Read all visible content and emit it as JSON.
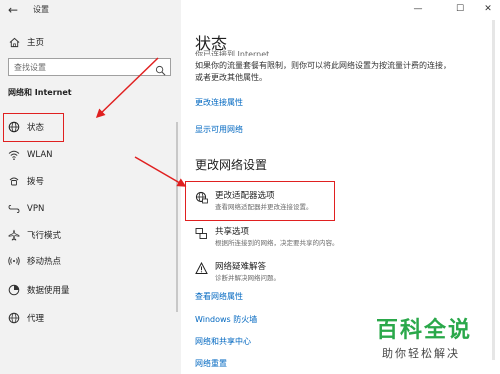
{
  "window": {
    "title": "设置",
    "back_icon": "←",
    "minimize_icon": "—",
    "maximize_icon": "☐",
    "close_icon": "✕"
  },
  "sidebar": {
    "home_label": "主页",
    "search_placeholder": "查找设置",
    "section_title": "网络和 Internet",
    "items": [
      {
        "label": "状态",
        "icon": "status-globe-icon"
      },
      {
        "label": "WLAN",
        "icon": "wifi-icon"
      },
      {
        "label": "拨号",
        "icon": "dialup-icon"
      },
      {
        "label": "VPN",
        "icon": "vpn-icon"
      },
      {
        "label": "飞行模式",
        "icon": "airplane-icon"
      },
      {
        "label": "移动热点",
        "icon": "hotspot-icon"
      },
      {
        "label": "数据使用量",
        "icon": "data-usage-icon"
      },
      {
        "label": "代理",
        "icon": "proxy-globe-icon"
      }
    ]
  },
  "main": {
    "title": "状态",
    "faded_line": "你已连接到 Internet",
    "body_text": "如果你的流量套餐有限制，则你可以将此网络设置为按流量计费的连接，或者更改其他属性。",
    "link_change_props": "更改连接属性",
    "link_show_networks": "显示可用网络",
    "change_header": "更改网络设置",
    "options": [
      {
        "title": "更改适配器选项",
        "desc": "查看网络适配器并更改连接设置。"
      },
      {
        "title": "共享选项",
        "desc": "根据所连接到的网络，决定要共享的内容。"
      },
      {
        "title": "网络疑难解答",
        "desc": "诊断并解决网络问题。"
      }
    ],
    "link_view_props": "查看网络属性",
    "link_firewall": "Windows 防火墙",
    "link_sharing_center": "网络和共享中心",
    "link_reset": "网络重置"
  },
  "watermark": {
    "main": "百科全说",
    "sub": "助你轻松解决"
  },
  "colors": {
    "accent": "#0067c0",
    "annotation_red": "#e02020",
    "sidebar_bg": "#f2f2f2",
    "watermark_green": "#2aa84a"
  }
}
